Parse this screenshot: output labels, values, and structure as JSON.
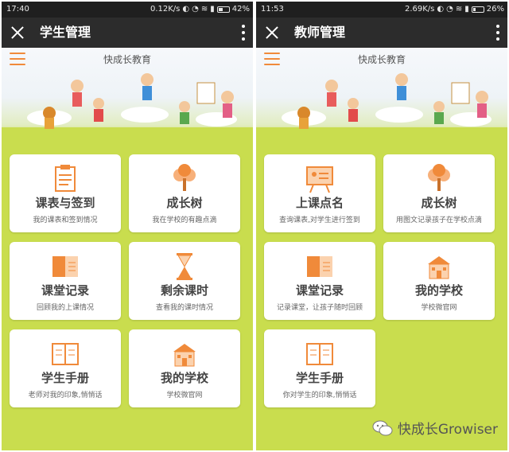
{
  "colors": {
    "accent": "#f08a3a",
    "background": "#c9dd4e",
    "appbar": "#2c2c2c"
  },
  "left": {
    "status": {
      "time": "17:40",
      "speed": "0.12K/s",
      "battery": "42%",
      "battery_level": 0.42
    },
    "appbar": {
      "title": "学生管理"
    },
    "header": {
      "brand": "快成长教育"
    },
    "cards": [
      {
        "icon": "clipboard-icon",
        "label": "课表与签到",
        "sub": "我的课表和签到情况"
      },
      {
        "icon": "tree-icon",
        "label": "成长树",
        "sub": "我在学校的有趣点滴"
      },
      {
        "icon": "book-icon",
        "label": "课堂记录",
        "sub": "回顾我的上课情况"
      },
      {
        "icon": "hourglass-icon",
        "label": "剩余课时",
        "sub": "查看我的课时情况"
      },
      {
        "icon": "handbook-icon",
        "label": "学生手册",
        "sub": "老师对我的印象,悄悄话"
      },
      {
        "icon": "school-icon",
        "label": "我的学校",
        "sub": "学校微官网"
      }
    ]
  },
  "right": {
    "status": {
      "time": "11:53",
      "speed": "2.69K/s",
      "battery": "26%",
      "battery_level": 0.26
    },
    "appbar": {
      "title": "教师管理"
    },
    "header": {
      "brand": "快成长教育"
    },
    "cards": [
      {
        "icon": "blackboard-icon",
        "label": "上课点名",
        "sub": "查询课表,对学生进行签到"
      },
      {
        "icon": "tree-icon",
        "label": "成长树",
        "sub": "用图文记录孩子在学校点滴"
      },
      {
        "icon": "book-icon",
        "label": "课堂记录",
        "sub": "记录课堂，让孩子随时回顾"
      },
      {
        "icon": "school-icon",
        "label": "我的学校",
        "sub": "学校微官网"
      },
      {
        "icon": "handbook-icon",
        "label": "学生手册",
        "sub": "你对学生的印象,悄悄话"
      }
    ]
  },
  "watermark": {
    "text": "快成长Growiser",
    "icon": "wechat-icon"
  }
}
